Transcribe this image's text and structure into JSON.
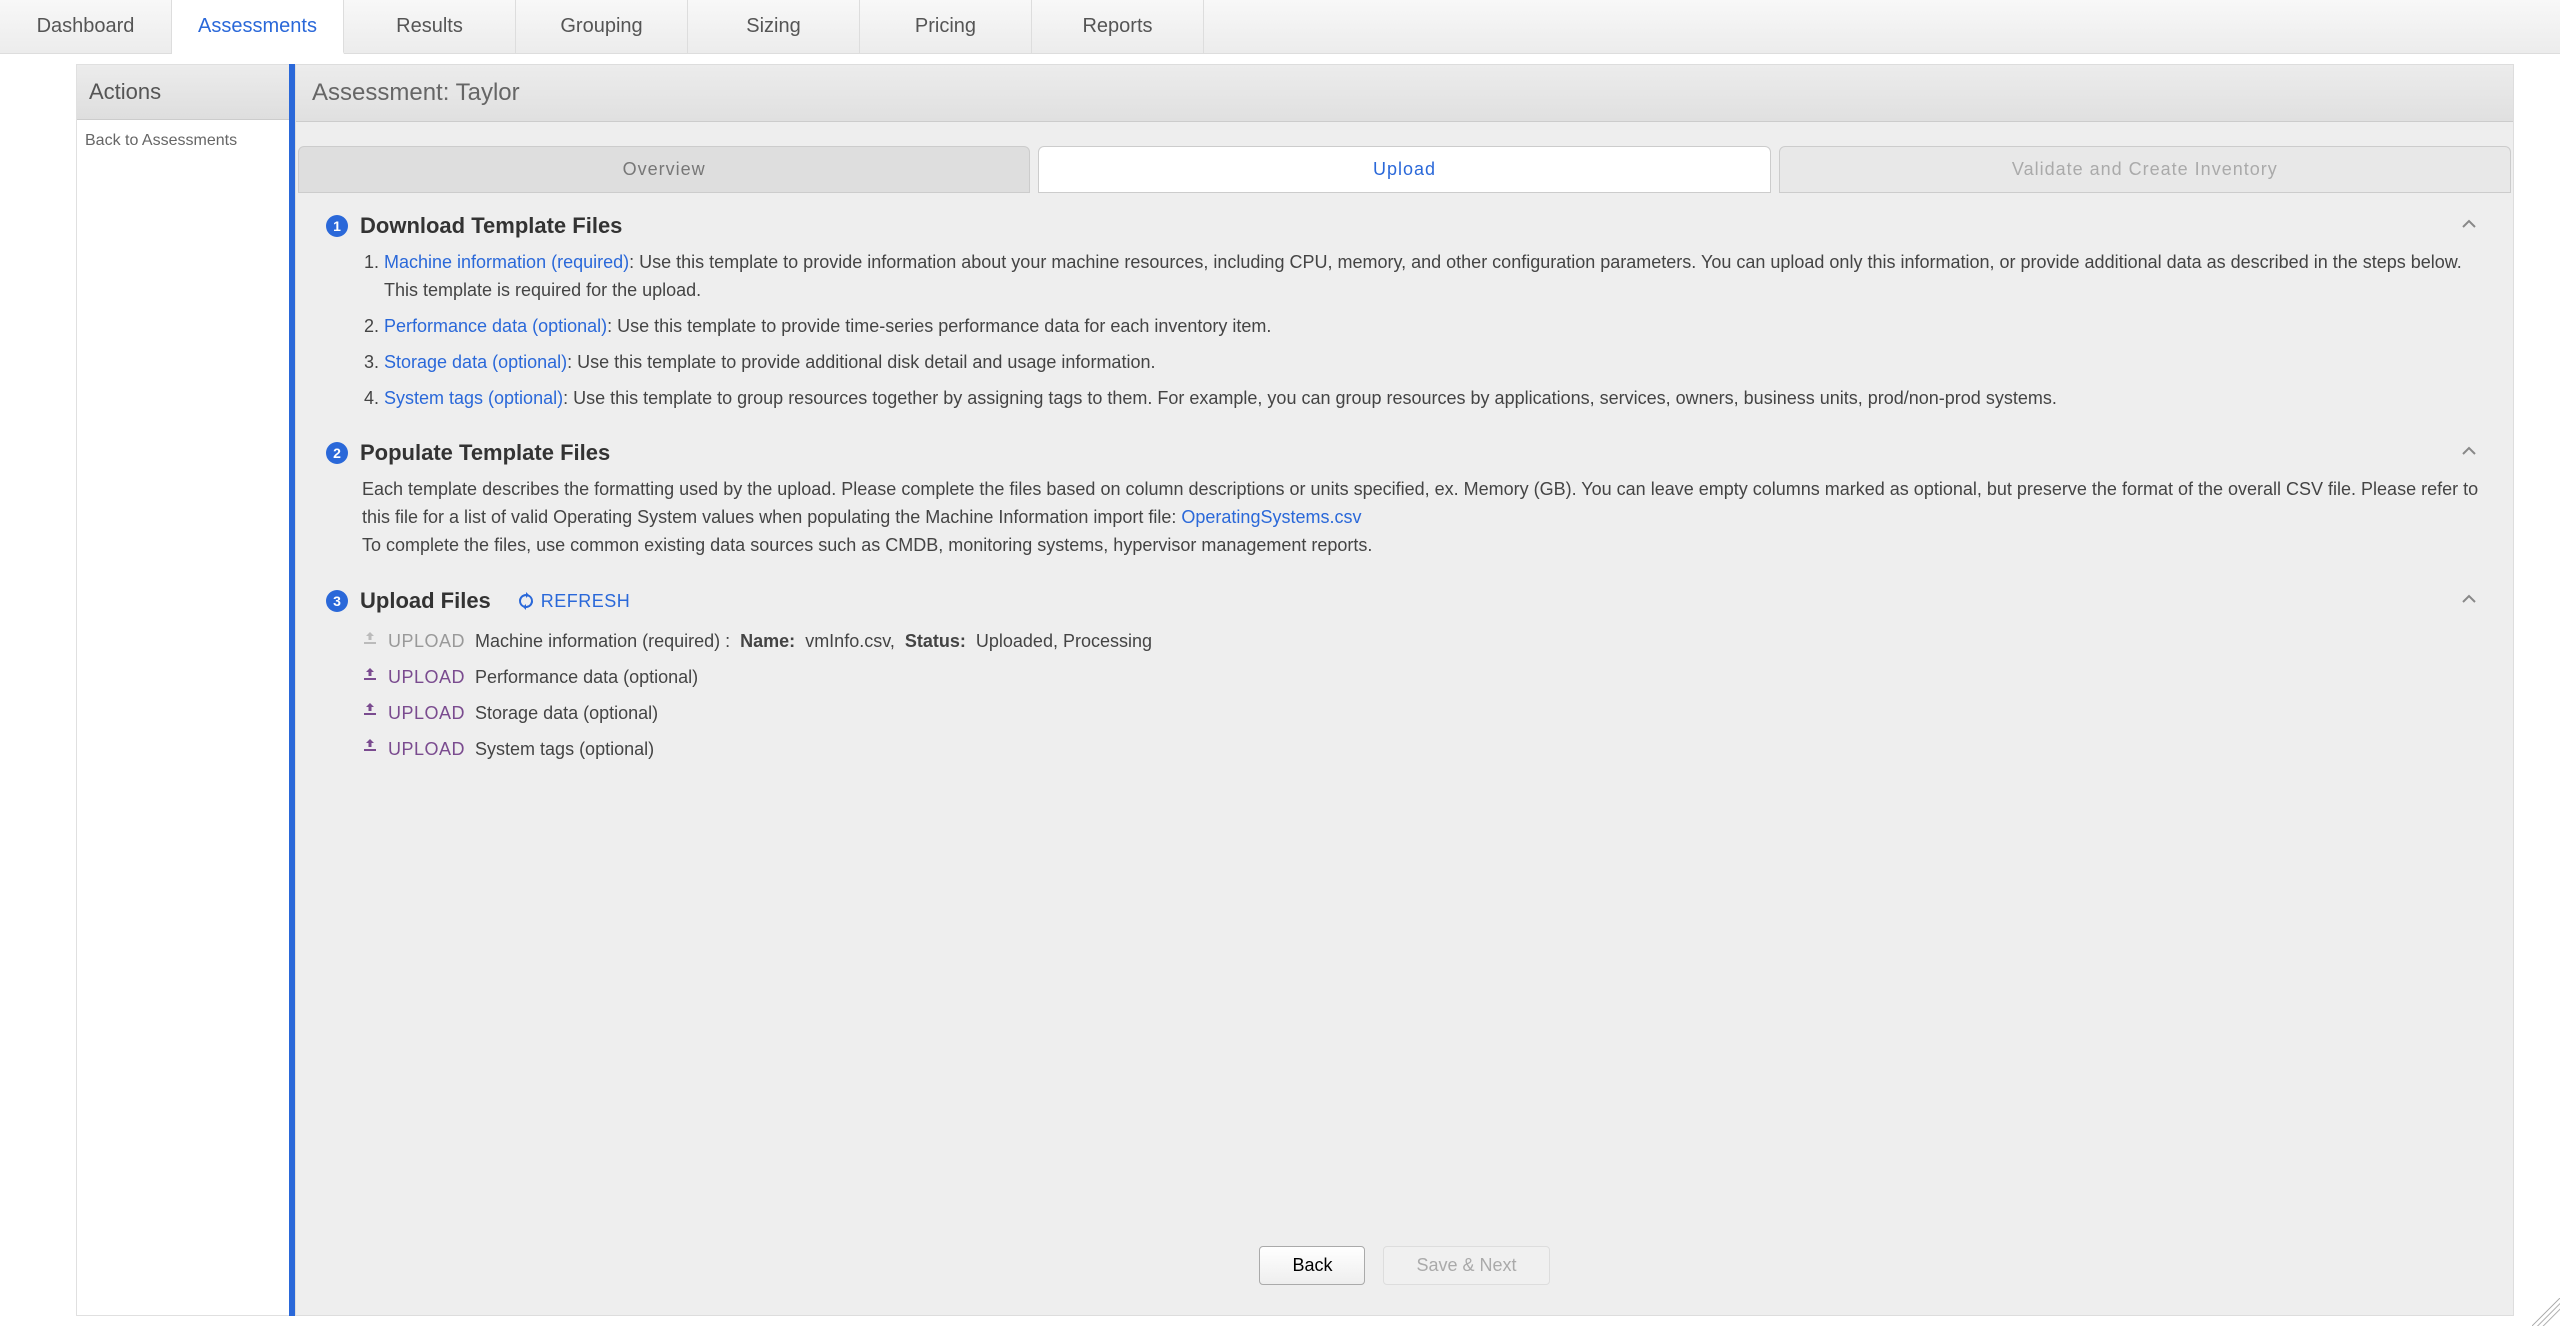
{
  "nav": {
    "tabs": [
      "Dashboard",
      "Assessments",
      "Results",
      "Grouping",
      "Sizing",
      "Pricing",
      "Reports"
    ],
    "active_index": 1
  },
  "sidebar": {
    "title": "Actions",
    "back_link": "Back to Assessments"
  },
  "header": {
    "title": "Assessment: Taylor"
  },
  "wizard": {
    "tabs": [
      "Overview",
      "Upload",
      "Validate and Create Inventory"
    ],
    "active_index": 1,
    "disabled_index": 2
  },
  "section1": {
    "num": "1",
    "title": "Download Template Files",
    "items": [
      {
        "link": "Machine information (required)",
        "text": ": Use this template to provide information about your machine resources, including CPU, memory, and other configuration parameters. You can upload only this information, or provide additional data as described in the steps below. This template is required for the upload."
      },
      {
        "link": "Performance data (optional)",
        "text": ": Use this template to provide time-series performance data for each inventory item."
      },
      {
        "link": "Storage data (optional)",
        "text": ": Use this template to provide additional disk detail and usage information."
      },
      {
        "link": "System tags (optional)",
        "text": ": Use this template to group resources together by assigning tags to them. For example, you can group resources by applications, services, owners, business units, prod/non-prod systems."
      }
    ]
  },
  "section2": {
    "num": "2",
    "title": "Populate Template Files",
    "para1": "Each template describes the formatting used by the upload. Please complete the files based on column descriptions or units specified, ex. Memory (GB). You can leave empty columns marked as optional, but preserve the format of the overall CSV file. Please refer to this file for a list of valid Operating System values when populating the Machine Information import file: ",
    "link": "OperatingSystems.csv",
    "para2": "To complete the files, use common existing data sources such as CMDB, monitoring systems, hypervisor management reports."
  },
  "section3": {
    "num": "3",
    "title": "Upload Files",
    "refresh": "REFRESH",
    "upload_label": "UPLOAD",
    "rows": [
      {
        "enabled": false,
        "desc": "Machine information (required) :",
        "name_label": "Name:",
        "name": "vmInfo.csv,",
        "status_label": "Status:",
        "status": "Uploaded, Processing"
      },
      {
        "enabled": true,
        "desc": "Performance data (optional)"
      },
      {
        "enabled": true,
        "desc": "Storage data (optional)"
      },
      {
        "enabled": true,
        "desc": "System tags (optional)"
      }
    ]
  },
  "footer": {
    "back": "Back",
    "next": "Save & Next"
  }
}
